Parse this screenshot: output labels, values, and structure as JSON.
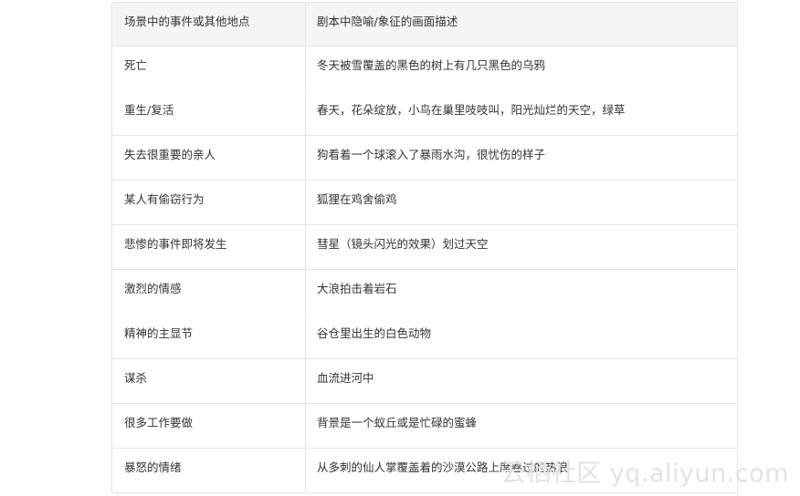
{
  "table": {
    "headers": [
      "场景中的事件或其他地点",
      "剧本中隐喻/象征的画面描述"
    ],
    "rows": [
      [
        "死亡",
        "冬天被雪覆盖的黑色的树上有几只黑色的乌鸦"
      ],
      [
        "重生/复活",
        "春天，花朵绽放，小鸟在巢里吱吱叫，阳光灿烂的天空，绿草"
      ],
      [
        "失去很重要的亲人",
        "狗看着一个球滚入了暴雨水沟，很忧伤的样子"
      ],
      [
        "某人有偷窃行为",
        "狐狸在鸡舍偷鸡"
      ],
      [
        "悲惨的事件即将发生",
        "彗星（镜头闪光的效果）划过天空"
      ],
      [
        "激烈的情感",
        "大浪拍击着岩石"
      ],
      [
        "精神的主显节",
        "谷仓里出生的白色动物"
      ],
      [
        "谋杀",
        "血流进河中"
      ],
      [
        "很多工作要做",
        "背景是一个蚁丘或是忙碌的蜜蜂"
      ],
      [
        "暴怒的情绪",
        "从多刺的仙人掌覆盖着的沙漠公路上席卷过的热浪"
      ]
    ]
  },
  "watermark": "云栖社区 yq.aliyun.com"
}
